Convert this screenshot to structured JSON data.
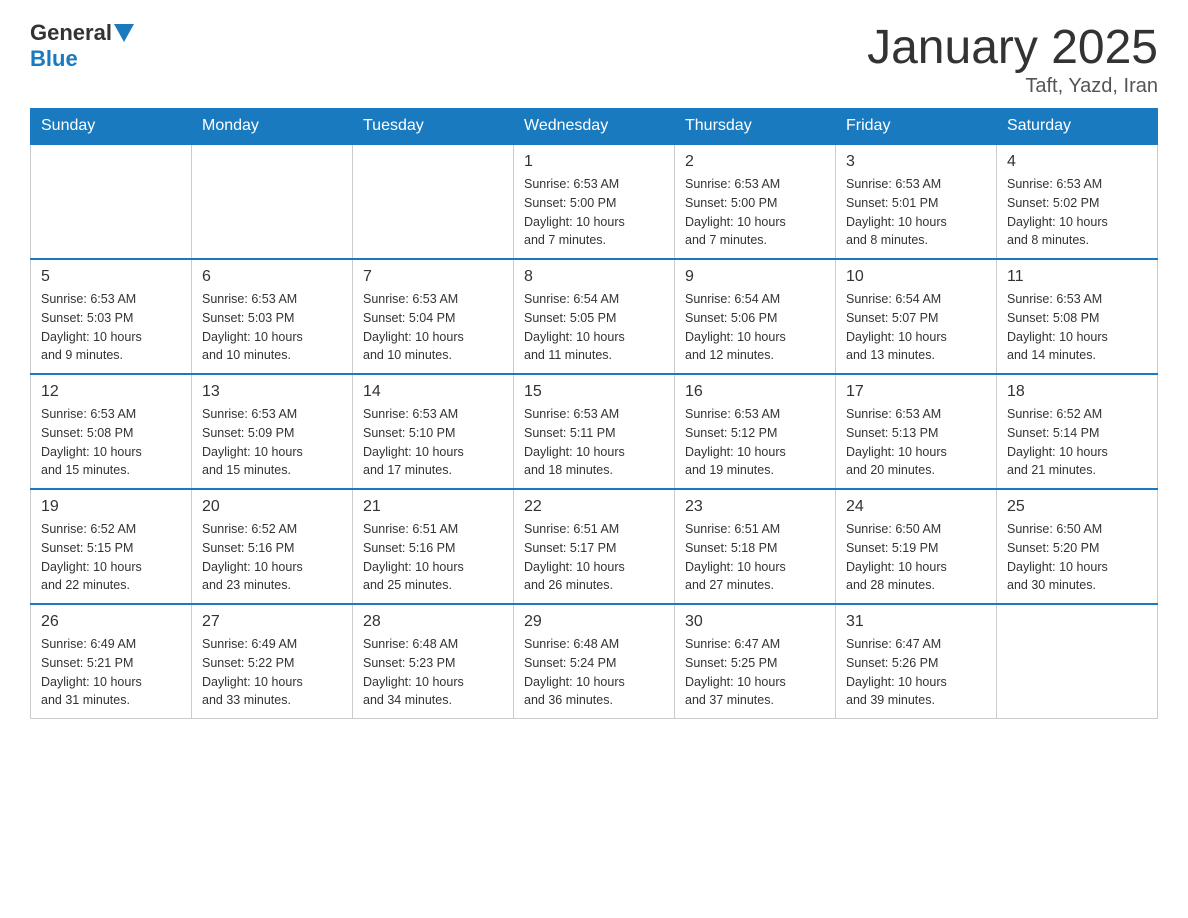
{
  "header": {
    "logo": {
      "text1": "General",
      "text2": "Blue"
    },
    "title": "January 2025",
    "location": "Taft, Yazd, Iran"
  },
  "weekdays": [
    "Sunday",
    "Monday",
    "Tuesday",
    "Wednesday",
    "Thursday",
    "Friday",
    "Saturday"
  ],
  "weeks": [
    [
      {
        "day": "",
        "info": ""
      },
      {
        "day": "",
        "info": ""
      },
      {
        "day": "",
        "info": ""
      },
      {
        "day": "1",
        "info": "Sunrise: 6:53 AM\nSunset: 5:00 PM\nDaylight: 10 hours\nand 7 minutes."
      },
      {
        "day": "2",
        "info": "Sunrise: 6:53 AM\nSunset: 5:00 PM\nDaylight: 10 hours\nand 7 minutes."
      },
      {
        "day": "3",
        "info": "Sunrise: 6:53 AM\nSunset: 5:01 PM\nDaylight: 10 hours\nand 8 minutes."
      },
      {
        "day": "4",
        "info": "Sunrise: 6:53 AM\nSunset: 5:02 PM\nDaylight: 10 hours\nand 8 minutes."
      }
    ],
    [
      {
        "day": "5",
        "info": "Sunrise: 6:53 AM\nSunset: 5:03 PM\nDaylight: 10 hours\nand 9 minutes."
      },
      {
        "day": "6",
        "info": "Sunrise: 6:53 AM\nSunset: 5:03 PM\nDaylight: 10 hours\nand 10 minutes."
      },
      {
        "day": "7",
        "info": "Sunrise: 6:53 AM\nSunset: 5:04 PM\nDaylight: 10 hours\nand 10 minutes."
      },
      {
        "day": "8",
        "info": "Sunrise: 6:54 AM\nSunset: 5:05 PM\nDaylight: 10 hours\nand 11 minutes."
      },
      {
        "day": "9",
        "info": "Sunrise: 6:54 AM\nSunset: 5:06 PM\nDaylight: 10 hours\nand 12 minutes."
      },
      {
        "day": "10",
        "info": "Sunrise: 6:54 AM\nSunset: 5:07 PM\nDaylight: 10 hours\nand 13 minutes."
      },
      {
        "day": "11",
        "info": "Sunrise: 6:53 AM\nSunset: 5:08 PM\nDaylight: 10 hours\nand 14 minutes."
      }
    ],
    [
      {
        "day": "12",
        "info": "Sunrise: 6:53 AM\nSunset: 5:08 PM\nDaylight: 10 hours\nand 15 minutes."
      },
      {
        "day": "13",
        "info": "Sunrise: 6:53 AM\nSunset: 5:09 PM\nDaylight: 10 hours\nand 15 minutes."
      },
      {
        "day": "14",
        "info": "Sunrise: 6:53 AM\nSunset: 5:10 PM\nDaylight: 10 hours\nand 17 minutes."
      },
      {
        "day": "15",
        "info": "Sunrise: 6:53 AM\nSunset: 5:11 PM\nDaylight: 10 hours\nand 18 minutes."
      },
      {
        "day": "16",
        "info": "Sunrise: 6:53 AM\nSunset: 5:12 PM\nDaylight: 10 hours\nand 19 minutes."
      },
      {
        "day": "17",
        "info": "Sunrise: 6:53 AM\nSunset: 5:13 PM\nDaylight: 10 hours\nand 20 minutes."
      },
      {
        "day": "18",
        "info": "Sunrise: 6:52 AM\nSunset: 5:14 PM\nDaylight: 10 hours\nand 21 minutes."
      }
    ],
    [
      {
        "day": "19",
        "info": "Sunrise: 6:52 AM\nSunset: 5:15 PM\nDaylight: 10 hours\nand 22 minutes."
      },
      {
        "day": "20",
        "info": "Sunrise: 6:52 AM\nSunset: 5:16 PM\nDaylight: 10 hours\nand 23 minutes."
      },
      {
        "day": "21",
        "info": "Sunrise: 6:51 AM\nSunset: 5:16 PM\nDaylight: 10 hours\nand 25 minutes."
      },
      {
        "day": "22",
        "info": "Sunrise: 6:51 AM\nSunset: 5:17 PM\nDaylight: 10 hours\nand 26 minutes."
      },
      {
        "day": "23",
        "info": "Sunrise: 6:51 AM\nSunset: 5:18 PM\nDaylight: 10 hours\nand 27 minutes."
      },
      {
        "day": "24",
        "info": "Sunrise: 6:50 AM\nSunset: 5:19 PM\nDaylight: 10 hours\nand 28 minutes."
      },
      {
        "day": "25",
        "info": "Sunrise: 6:50 AM\nSunset: 5:20 PM\nDaylight: 10 hours\nand 30 minutes."
      }
    ],
    [
      {
        "day": "26",
        "info": "Sunrise: 6:49 AM\nSunset: 5:21 PM\nDaylight: 10 hours\nand 31 minutes."
      },
      {
        "day": "27",
        "info": "Sunrise: 6:49 AM\nSunset: 5:22 PM\nDaylight: 10 hours\nand 33 minutes."
      },
      {
        "day": "28",
        "info": "Sunrise: 6:48 AM\nSunset: 5:23 PM\nDaylight: 10 hours\nand 34 minutes."
      },
      {
        "day": "29",
        "info": "Sunrise: 6:48 AM\nSunset: 5:24 PM\nDaylight: 10 hours\nand 36 minutes."
      },
      {
        "day": "30",
        "info": "Sunrise: 6:47 AM\nSunset: 5:25 PM\nDaylight: 10 hours\nand 37 minutes."
      },
      {
        "day": "31",
        "info": "Sunrise: 6:47 AM\nSunset: 5:26 PM\nDaylight: 10 hours\nand 39 minutes."
      },
      {
        "day": "",
        "info": ""
      }
    ]
  ]
}
